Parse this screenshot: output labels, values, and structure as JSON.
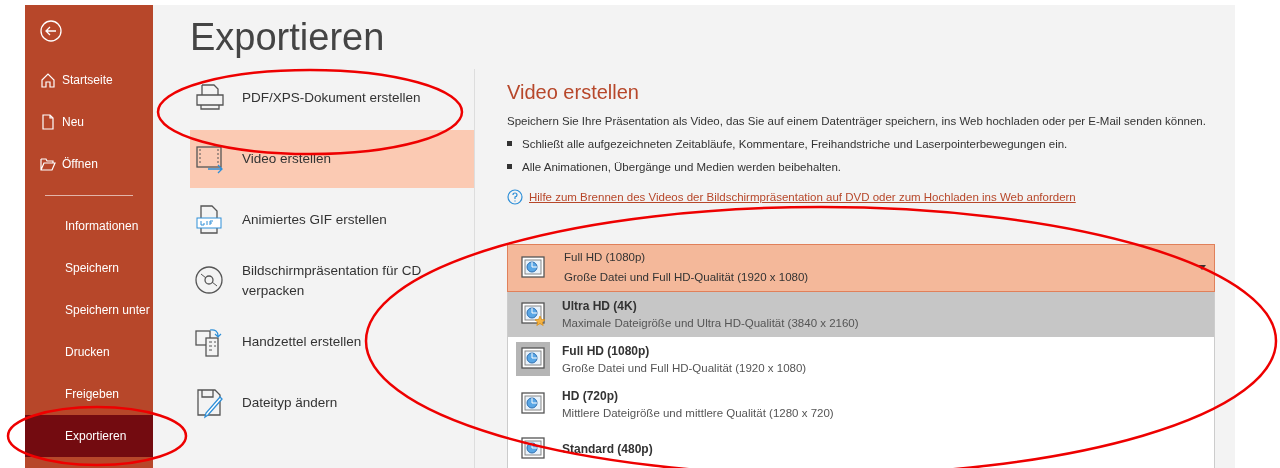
{
  "sidebar": {
    "items": [
      {
        "label": "Startseite",
        "kind": "home",
        "selected": false
      },
      {
        "label": "Neu",
        "kind": "new",
        "selected": false
      },
      {
        "label": "Öffnen",
        "kind": "open",
        "selected": false
      },
      {
        "label": "Informationen",
        "kind": "page",
        "selected": false
      },
      {
        "label": "Speichern",
        "kind": "page",
        "selected": false
      },
      {
        "label": "Speichern unter",
        "kind": "page",
        "selected": false
      },
      {
        "label": "Drucken",
        "kind": "page",
        "selected": false
      },
      {
        "label": "Freigeben",
        "kind": "page",
        "selected": false
      },
      {
        "label": "Exportieren",
        "kind": "page",
        "selected": true
      }
    ]
  },
  "page_title": "Exportieren",
  "export_options": [
    {
      "label": "PDF/XPS-Dokument erstellen",
      "kind": "pdf",
      "selected": false
    },
    {
      "label": "Video erstellen",
      "kind": "video",
      "selected": true
    },
    {
      "label": "Animiertes GIF erstellen",
      "kind": "gif",
      "selected": false
    },
    {
      "label": "Bildschirmpräsentation für CD verpacken",
      "kind": "cd",
      "selected": false
    },
    {
      "label": "Handzettel erstellen",
      "kind": "handout",
      "selected": false
    },
    {
      "label": "Dateityp ändern",
      "kind": "filetype",
      "selected": false
    }
  ],
  "detail": {
    "title": "Video erstellen",
    "description": "Speichern Sie Ihre Präsentation als Video, das Sie auf einem Datenträger speichern, ins Web hochladen oder per E-Mail senden können.",
    "bullets": [
      "Schließt alle aufgezeichneten Zeitabläufe, Kommentare, Freihandstriche und Laserpointerbewegungen ein.",
      "Alle Animationen, Übergänge und Medien werden beibehalten."
    ],
    "help_link": "Hilfe zum Brennen des Videos der Bildschirmpräsentation auf DVD oder zum Hochladen ins Web anfordern",
    "quality_dropdown": {
      "title": "Full HD (1080p)",
      "subtitle": "Große Datei und Full HD-Qualität (1920 x 1080)",
      "expanded": true,
      "options": [
        {
          "title": "Ultra HD (4K)",
          "subtitle": "Maximale Dateigröße und Ultra HD-Qualität (3840 x 2160)",
          "kind": "uhd",
          "highlighted": true,
          "selected": false
        },
        {
          "title": "Full HD (1080p)",
          "subtitle": "Große Datei und Full HD-Qualität (1920 x 1080)",
          "kind": "fhd",
          "highlighted": false,
          "selected": true
        },
        {
          "title": "HD (720p)",
          "subtitle": "Mittlere Dateigröße und mittlere Qualität (1280 x 720)",
          "kind": "hd",
          "highlighted": false,
          "selected": false
        },
        {
          "title": "Standard (480p)",
          "kind": "sd",
          "highlighted": false,
          "selected": false
        }
      ]
    }
  }
}
